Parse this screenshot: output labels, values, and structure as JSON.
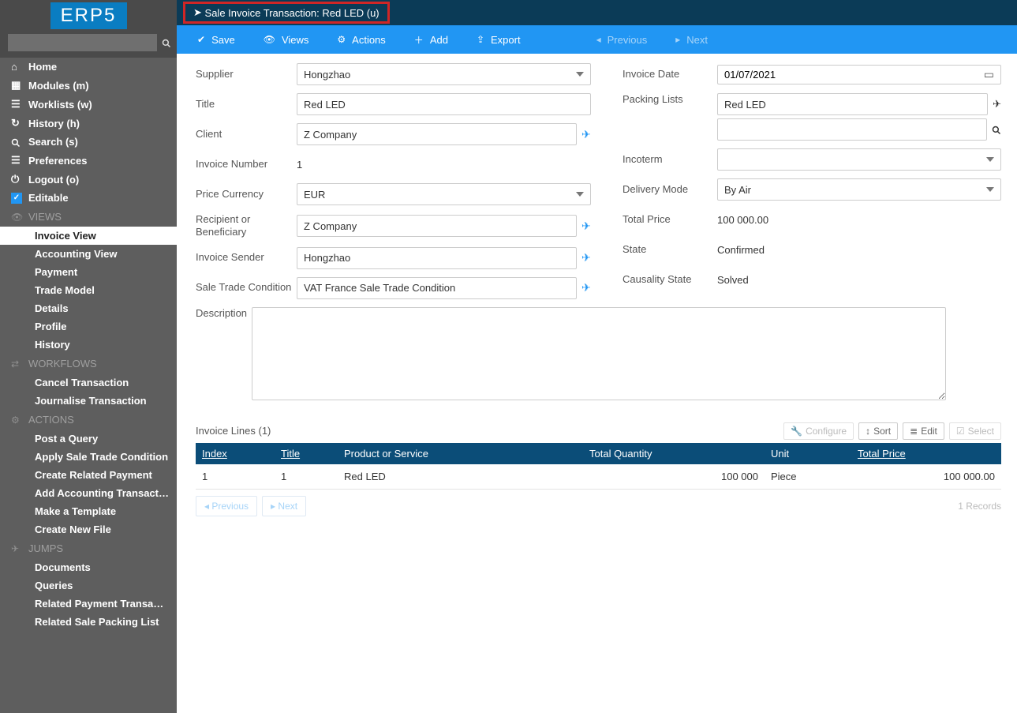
{
  "logo": "ERP5",
  "sidebar": {
    "nav": [
      {
        "icon": "home",
        "label": "Home"
      },
      {
        "icon": "grid",
        "label": "Modules (m)"
      },
      {
        "icon": "list",
        "label": "Worklists (w)"
      },
      {
        "icon": "history",
        "label": "History (h)"
      },
      {
        "icon": "search",
        "label": "Search (s)"
      },
      {
        "icon": "sliders",
        "label": "Preferences"
      },
      {
        "icon": "power",
        "label": "Logout (o)"
      },
      {
        "icon": "check",
        "label": "Editable"
      }
    ],
    "views_head": "VIEWS",
    "views": [
      {
        "label": "Invoice View",
        "active": true
      },
      {
        "label": "Accounting View"
      },
      {
        "label": "Payment"
      },
      {
        "label": "Trade Model"
      },
      {
        "label": "Details"
      },
      {
        "label": "Profile"
      },
      {
        "label": "History"
      }
    ],
    "workflows_head": "WORKFLOWS",
    "workflows": [
      {
        "label": "Cancel Transaction"
      },
      {
        "label": "Journalise Transaction"
      }
    ],
    "actions_head": "ACTIONS",
    "actions": [
      {
        "label": "Post a Query"
      },
      {
        "label": "Apply Sale Trade Condition"
      },
      {
        "label": "Create Related Payment"
      },
      {
        "label": "Add Accounting Transaction L..."
      },
      {
        "label": "Make a Template"
      },
      {
        "label": "Create New File"
      }
    ],
    "jumps_head": "JUMPS",
    "jumps": [
      {
        "label": "Documents"
      },
      {
        "label": "Queries"
      },
      {
        "label": "Related Payment Transaction"
      },
      {
        "label": "Related Sale Packing List"
      }
    ]
  },
  "titlebar": {
    "text": "Sale Invoice Transaction: Red LED (u)"
  },
  "toolbar": {
    "save": "Save",
    "views": "Views",
    "actions": "Actions",
    "add": "Add",
    "export": "Export",
    "previous": "Previous",
    "next": "Next"
  },
  "form": {
    "labels": {
      "supplier": "Supplier",
      "title": "Title",
      "client": "Client",
      "invoice_number": "Invoice Number",
      "price_currency": "Price Currency",
      "recipient": "Recipient or Beneficiary",
      "invoice_sender": "Invoice Sender",
      "sale_trade": "Sale Trade Condition",
      "description": "Description",
      "invoice_date": "Invoice Date",
      "packing_lists": "Packing Lists",
      "incoterm": "Incoterm",
      "delivery_mode": "Delivery Mode",
      "total_price": "Total Price",
      "state": "State",
      "causality": "Causality State"
    },
    "values": {
      "supplier": "Hongzhao",
      "title": "Red LED",
      "client": "Z Company",
      "invoice_number": "1",
      "price_currency": "EUR",
      "recipient": "Z Company",
      "invoice_sender": "Hongzhao",
      "sale_trade": "VAT France Sale Trade Condition",
      "description": "",
      "invoice_date": "01/07/2021",
      "packing_lists": "Red LED",
      "packing_lists_2": "",
      "incoterm": "",
      "delivery_mode": "By Air",
      "total_price": "100 000.00",
      "state": "Confirmed",
      "causality": "Solved"
    }
  },
  "table": {
    "title": "Invoice Lines (1)",
    "actions": {
      "configure": "Configure",
      "sort": "Sort",
      "edit": "Edit",
      "select": "Select"
    },
    "cols": {
      "index": "Index",
      "title": "Title",
      "product": "Product or Service",
      "qty": "Total Quantity",
      "unit": "Unit",
      "price": "Total Price"
    },
    "rows": [
      {
        "index": "1",
        "title": "1",
        "product": "Red LED",
        "qty": "100 000",
        "unit": "Piece",
        "price": "100 000.00"
      }
    ],
    "prev": "Previous",
    "next": "Next",
    "records": "1 Records"
  }
}
